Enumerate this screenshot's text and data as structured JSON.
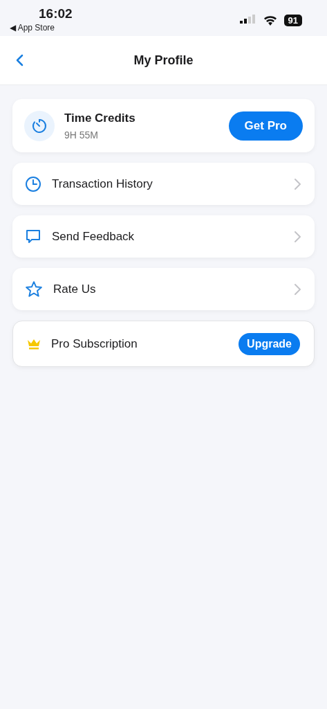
{
  "status_bar": {
    "time": "16:02",
    "back_label": "◀ App Store",
    "battery": "91"
  },
  "nav": {
    "title": "My Profile"
  },
  "credits": {
    "title": "Time Credits",
    "value": "9H 55M",
    "button": "Get Pro"
  },
  "menu": [
    {
      "kind": "link",
      "label": "Transaction History"
    },
    {
      "kind": "link",
      "label": "Send Feedback"
    },
    {
      "kind": "link",
      "label": "Rate Us"
    },
    {
      "kind": "upgrade",
      "label": "Pro Subscription",
      "button": "Upgrade"
    }
  ]
}
